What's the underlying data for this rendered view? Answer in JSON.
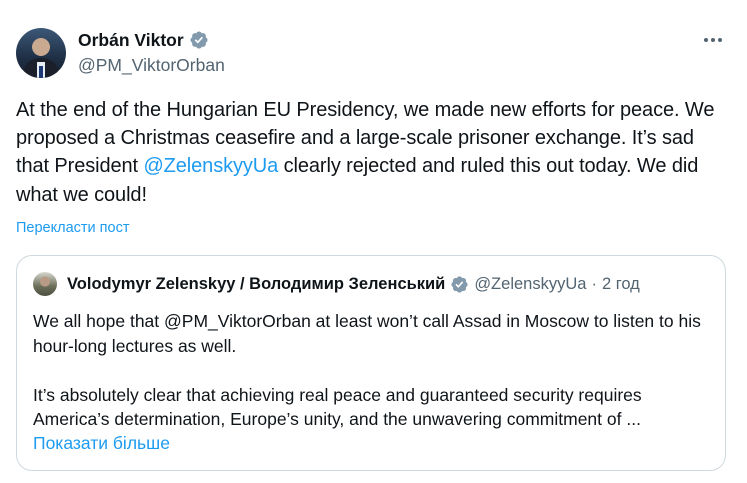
{
  "tweet": {
    "author": {
      "display_name": "Orbán Viktor",
      "handle": "@PM_ViktorOrban"
    },
    "text_before_mention": "At the end of the Hungarian EU Presidency, we made new efforts for peace. We proposed a Christmas ceasefire and a large-scale prisoner exchange. It’s sad that President ",
    "mention": "@ZelenskyyUa",
    "text_after_mention": " clearly rejected and ruled this out today. We did what we could!",
    "translate_label": "Перекласти пост"
  },
  "quote": {
    "author": {
      "display_name": "Volodymyr Zelenskyy / Володимир Зеленський",
      "handle": "@ZelenskyyUa",
      "separator": "·",
      "time": "2 год"
    },
    "paragraph_1": "We all hope that @PM_ViktorOrban at least won’t call Assad in Moscow to listen to his hour-long lectures as well.",
    "paragraph_2": "It’s absolutely clear that achieving real peace and guaranteed security requires America’s determination, Europe’s unity, and the unwavering commitment of ...",
    "show_more_label": "Показати більше"
  },
  "colors": {
    "accent": "#1d9bf0",
    "text": "#0f1419",
    "secondary": "#536471",
    "border": "#cfd9de"
  },
  "icons": {
    "verified": "verified-badge-icon",
    "more": "more-options-icon"
  }
}
